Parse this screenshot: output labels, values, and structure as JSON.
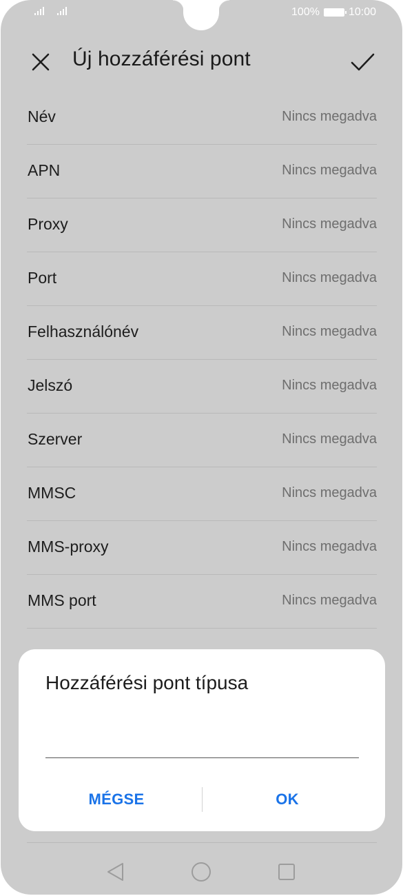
{
  "status_bar": {
    "battery_percent": "100%",
    "time": "10:00"
  },
  "header": {
    "title": "Új hozzáférési pont",
    "close_icon": "close-icon",
    "confirm_icon": "check-icon"
  },
  "fields": [
    {
      "label": "Név",
      "value": "Nincs megadva"
    },
    {
      "label": "APN",
      "value": "Nincs megadva"
    },
    {
      "label": "Proxy",
      "value": "Nincs megadva"
    },
    {
      "label": "Port",
      "value": "Nincs megadva"
    },
    {
      "label": "Felhasználónév",
      "value": "Nincs megadva"
    },
    {
      "label": "Jelszó",
      "value": "Nincs megadva"
    },
    {
      "label": "Szerver",
      "value": "Nincs megadva"
    },
    {
      "label": "MMSC",
      "value": "Nincs megadva"
    },
    {
      "label": "MMS-proxy",
      "value": "Nincs megadva"
    },
    {
      "label": "MMS port",
      "value": "Nincs megadva"
    }
  ],
  "dialog": {
    "title": "Hozzáférési pont típusa",
    "input_value": "",
    "cancel_label": "MÉGSE",
    "ok_label": "OK"
  },
  "colors": {
    "accent": "#1a73e8",
    "dim_background": "#cccccc"
  },
  "nav": {
    "back_icon": "back-triangle-icon",
    "home_icon": "home-circle-icon",
    "recent_icon": "recent-square-icon"
  }
}
